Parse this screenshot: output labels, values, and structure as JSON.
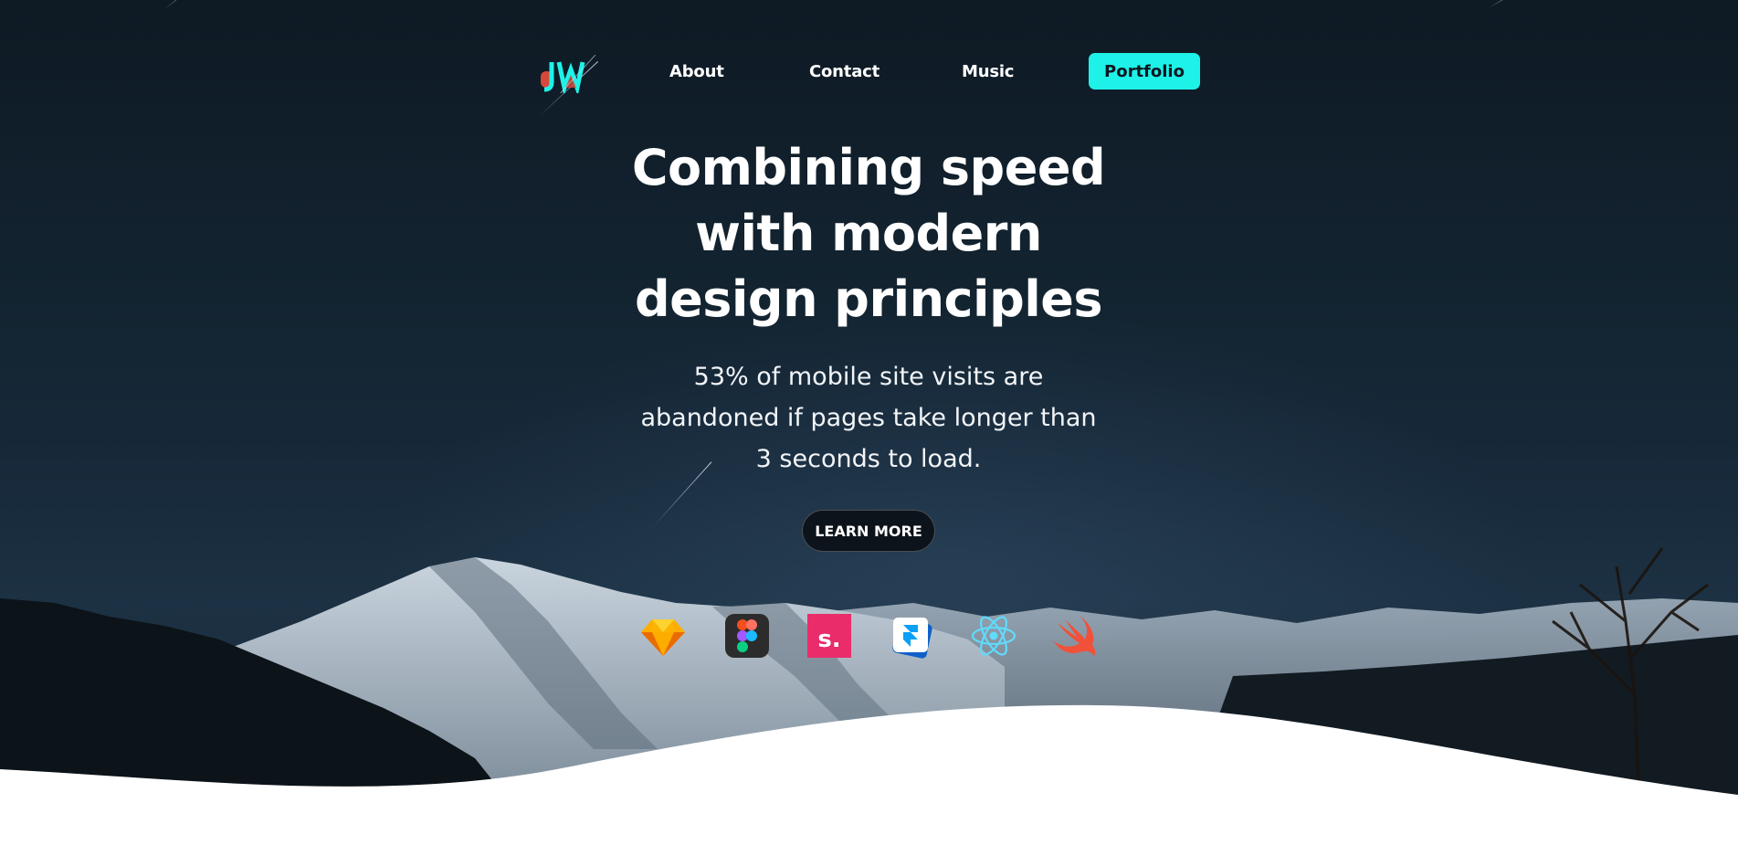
{
  "nav": {
    "logo_alt": "JW",
    "about": "About",
    "contact": "Contact",
    "music": "Music",
    "portfolio": "Portfolio"
  },
  "hero": {
    "headline_line1": "Combining speed",
    "headline_line2": "with modern",
    "headline_line3": "design principles",
    "subtext_line1": "53% of mobile site visits are",
    "subtext_line2": "abandoned if pages take longer than",
    "subtext_line3": "3 seconds to load.",
    "cta": "LEARN MORE"
  },
  "tools": [
    {
      "icon": "sketch-icon"
    },
    {
      "icon": "figma-icon"
    },
    {
      "icon": "slides-s-icon",
      "text": "s."
    },
    {
      "icon": "framer-icon"
    },
    {
      "icon": "react-icon"
    },
    {
      "icon": "swift-icon"
    }
  ],
  "colors": {
    "accent": "#1ef2e8",
    "sky": "#132431",
    "button_dark": "#0c131a",
    "logo_red": "#d8483a",
    "slides_pink": "#ea2c6b",
    "react_blue": "#61dafb",
    "swift_orange": "#f05138"
  }
}
